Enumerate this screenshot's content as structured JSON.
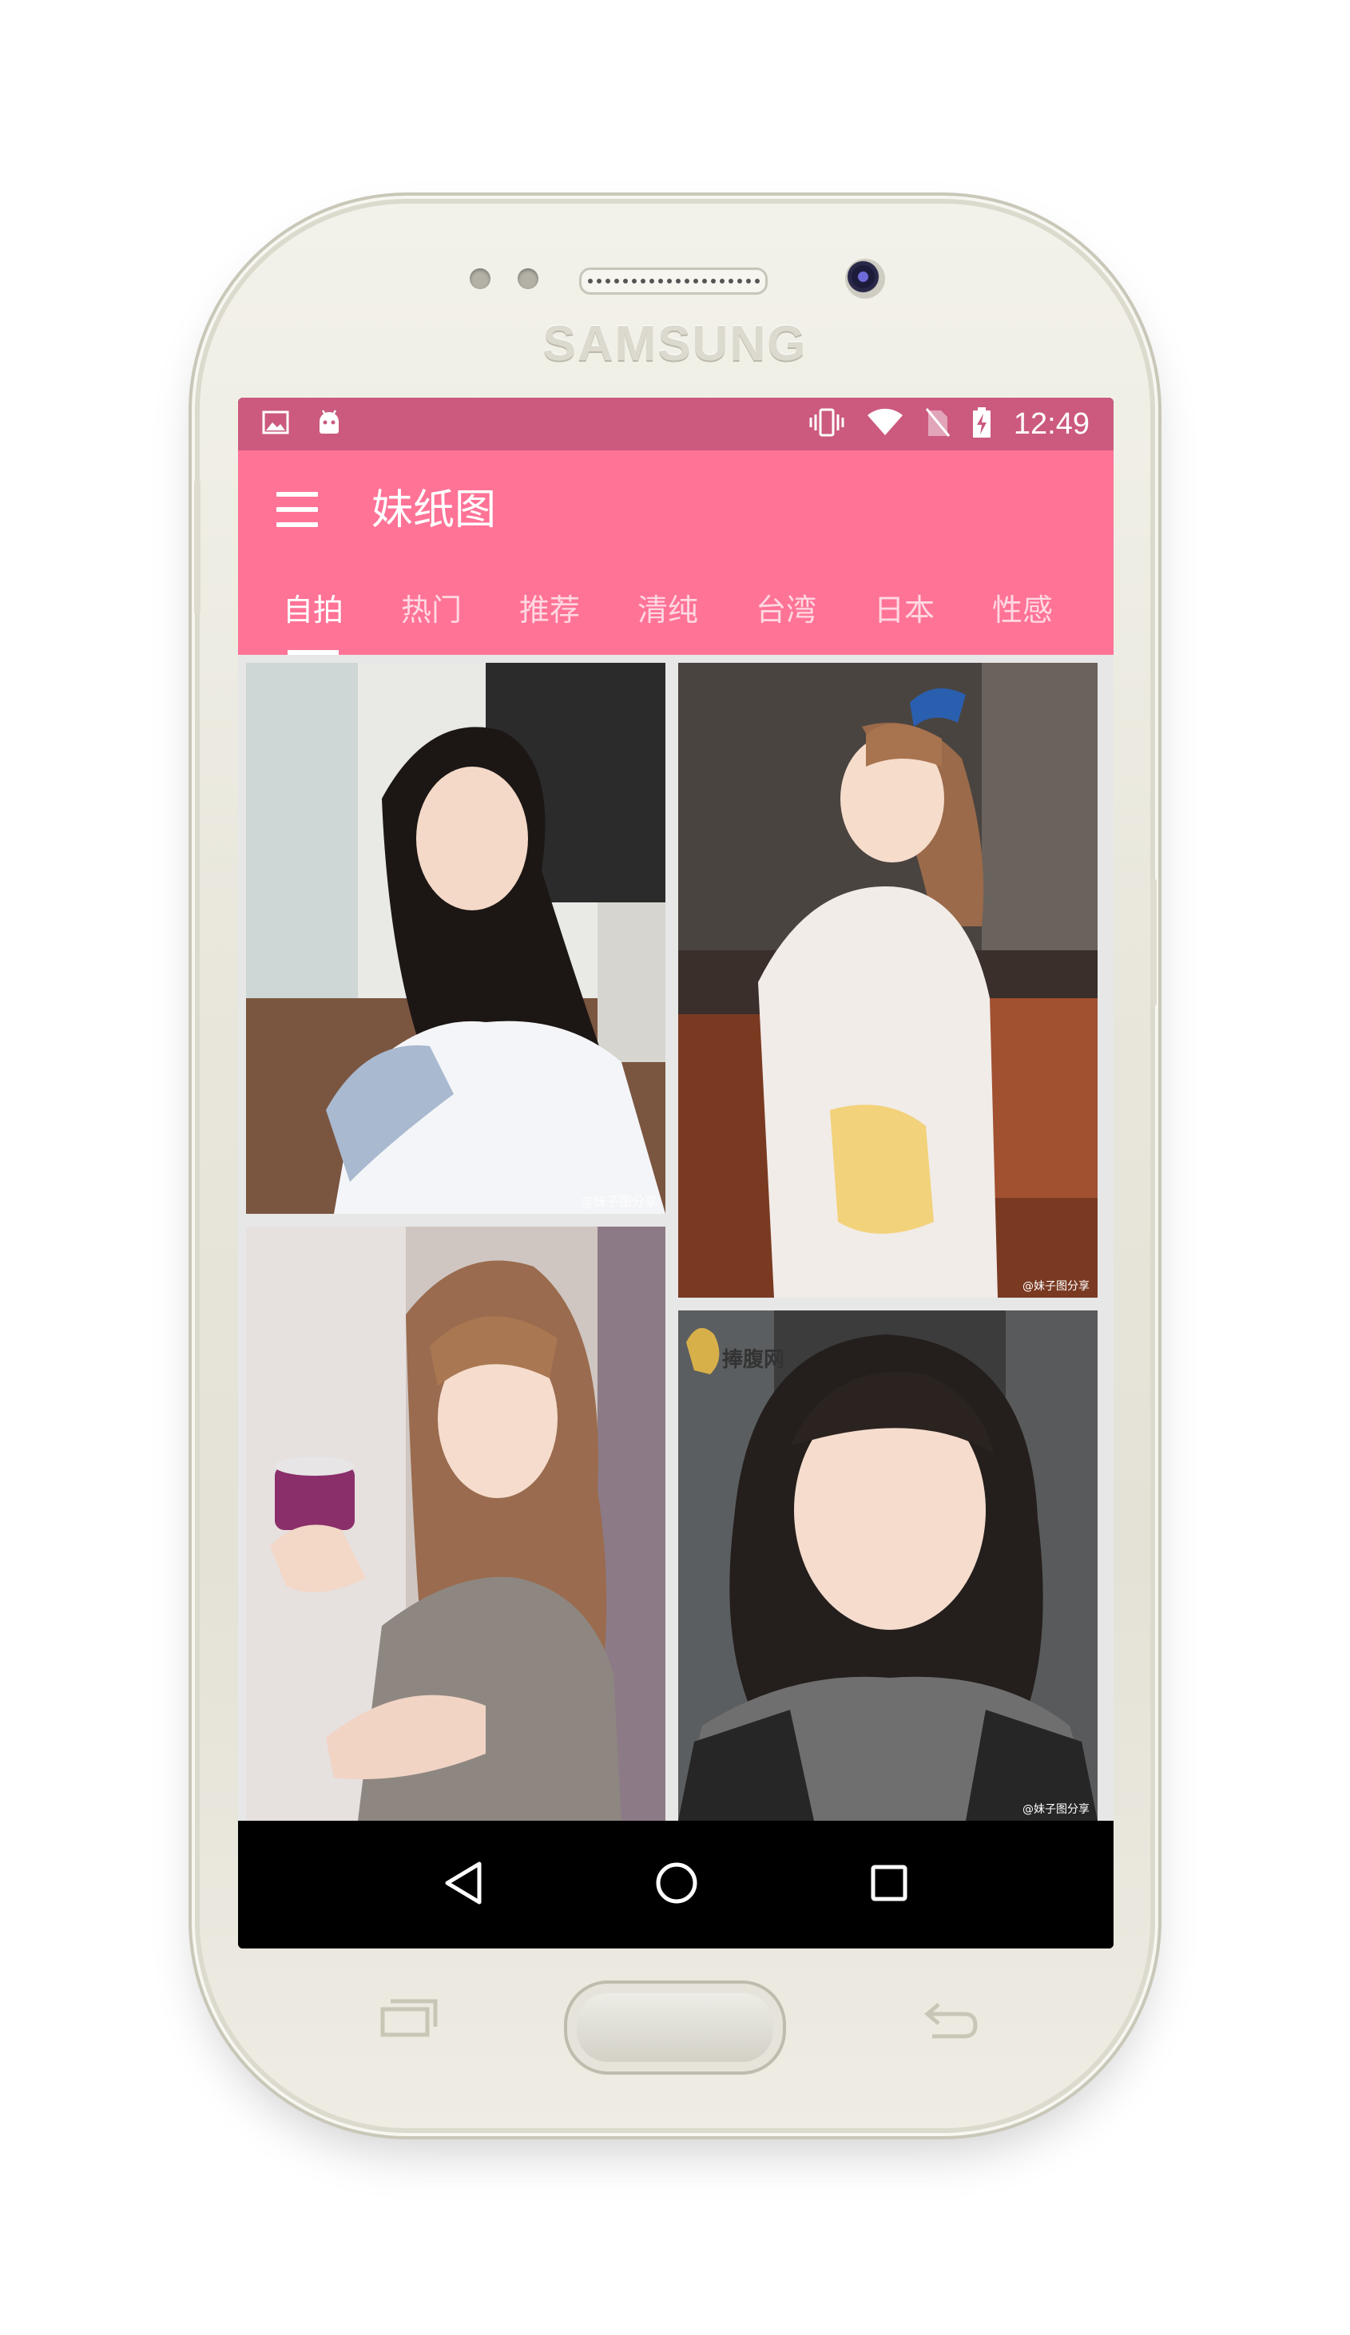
{
  "device": {
    "brand": "SAMSUNG"
  },
  "status_bar": {
    "left_icons": [
      "image-icon",
      "android-icon"
    ],
    "right_icons": [
      "vibrate-icon",
      "wifi-icon",
      "no-sim-icon",
      "battery-charging-icon"
    ],
    "time": "12:49"
  },
  "app_bar": {
    "title": "妹纸图",
    "tabs": [
      {
        "label": "自拍",
        "active": true
      },
      {
        "label": "热门",
        "active": false
      },
      {
        "label": "推荐",
        "active": false
      },
      {
        "label": "清纯",
        "active": false
      },
      {
        "label": "台湾",
        "active": false
      },
      {
        "label": "日本",
        "active": false
      },
      {
        "label": "性感",
        "active": false
      }
    ]
  },
  "gallery": {
    "items": [
      {
        "watermark": "@妹子图分享"
      },
      {
        "watermark": "@妹子图分享"
      },
      {
        "watermark": ""
      },
      {
        "watermark": "@妹子图分享",
        "logo_text": "捧腹网"
      }
    ]
  },
  "nav_bar": {
    "buttons": [
      "back-icon",
      "home-icon",
      "recents-icon"
    ]
  },
  "colors": {
    "status_bar": "#cb5a7e",
    "app_bar": "#ff7396",
    "content_bg": "#e7e7e7"
  }
}
